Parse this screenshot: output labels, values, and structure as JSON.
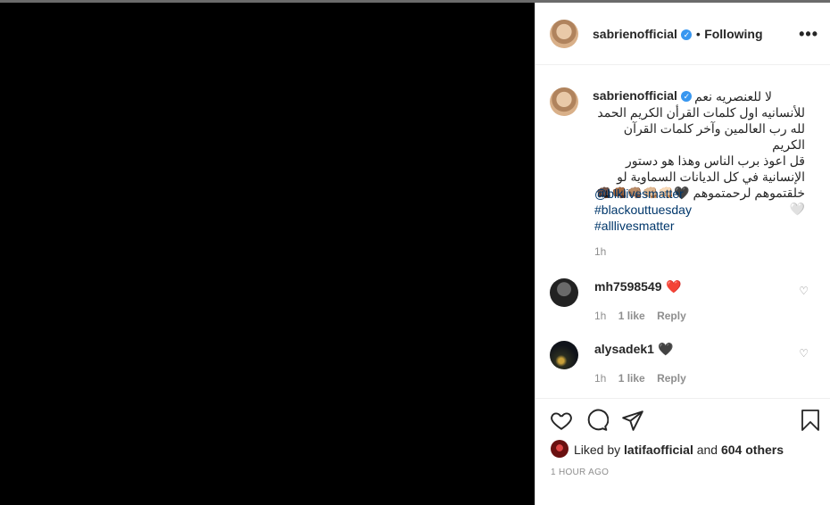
{
  "post": {
    "username": "sabrienofficial",
    "verified_badge": "✓",
    "separator": "•",
    "follow_label": "Following",
    "more_label": "•••"
  },
  "caption": {
    "username": "sabrienofficial",
    "lines": [
      "لا للعنصريه نعم",
      "للأنسانيه اول كلمات القرأن الكريم الحمد",
      "لله رب العالمين وآخر كلمات القرآن الكريم",
      "قل اعوذ برب الناس وهذا هو دستور",
      "الإنسانية في كل الديانات السماوية لو",
      "خلقتموهم لرحمتموهم 🖤👊🏻👊🏼👊🏽👊🏾👊🏿🤍"
    ],
    "tags": [
      "@blklivesmatter",
      "#blackouttuesday",
      "#alllivesmatter"
    ],
    "time": "1h"
  },
  "comments": [
    {
      "username": "mh7598549",
      "text": "❤️",
      "time": "1h",
      "likes": "1 like",
      "reply": "Reply"
    },
    {
      "username": "alysadek1",
      "text": "🖤",
      "time": "1h",
      "likes": "1 like",
      "reply": "Reply"
    }
  ],
  "likes": {
    "prefix": "Liked by",
    "user": "latifaofficial",
    "joiner": "and",
    "others": "604 others"
  },
  "timestamp": "1 HOUR AGO",
  "colors": {
    "media": "#000000",
    "link": "#00376b",
    "muted": "#8e8e8e",
    "verified": "#3897f0"
  }
}
